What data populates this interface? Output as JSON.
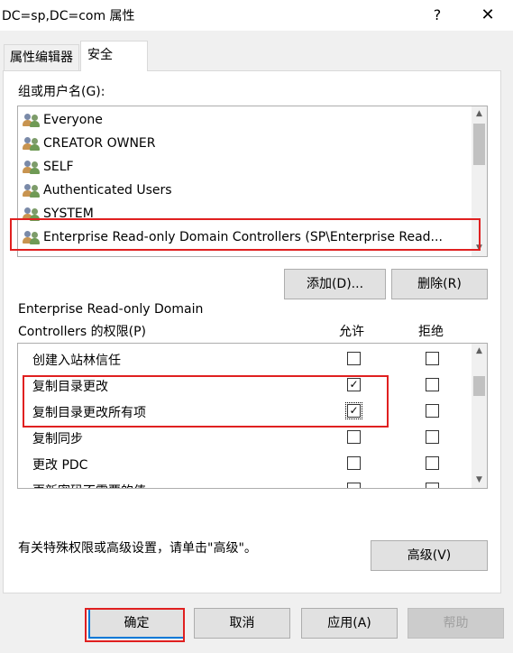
{
  "window": {
    "title": "DC=sp,DC=com 属性",
    "help_glyph": "?",
    "close_glyph": "✕"
  },
  "tabs": [
    {
      "label": "属性编辑器"
    },
    {
      "label": "安全"
    }
  ],
  "groups_label": "组或用户名(G):",
  "users": [
    {
      "name": "Everyone"
    },
    {
      "name": "CREATOR OWNER"
    },
    {
      "name": "SELF"
    },
    {
      "name": "Authenticated Users"
    },
    {
      "name": "SYSTEM"
    },
    {
      "name": "Enterprise Read-only Domain Controllers (SP\\Enterprise Read..."
    }
  ],
  "buttons": {
    "add": "添加(D)...",
    "remove": "删除(R)",
    "advanced": "高级(V)"
  },
  "permissions": {
    "title_line1": "Enterprise Read-only Domain",
    "title_line2": "Controllers 的权限(P)",
    "allow_header": "允许",
    "deny_header": "拒绝",
    "rows": [
      {
        "name": "创建入站林信任",
        "allow": false,
        "deny": false
      },
      {
        "name": "复制目录更改",
        "allow": true,
        "deny": false
      },
      {
        "name": "复制目录更改所有项",
        "allow": true,
        "deny": false
      },
      {
        "name": "复制同步",
        "allow": false,
        "deny": false
      },
      {
        "name": "更改 PDC",
        "allow": false,
        "deny": false
      },
      {
        "name": "更新密码不需要的值",
        "allow": false,
        "deny": false
      }
    ]
  },
  "advanced_hint": "有关特殊权限或高级设置，请单击\"高级\"。",
  "footer": {
    "ok": "确定",
    "cancel": "取消",
    "apply": "应用(A)",
    "help": "帮助"
  },
  "check_glyph": "✓",
  "colors": {
    "highlight_box": "#e02020",
    "default_button_border": "#0078d7"
  }
}
